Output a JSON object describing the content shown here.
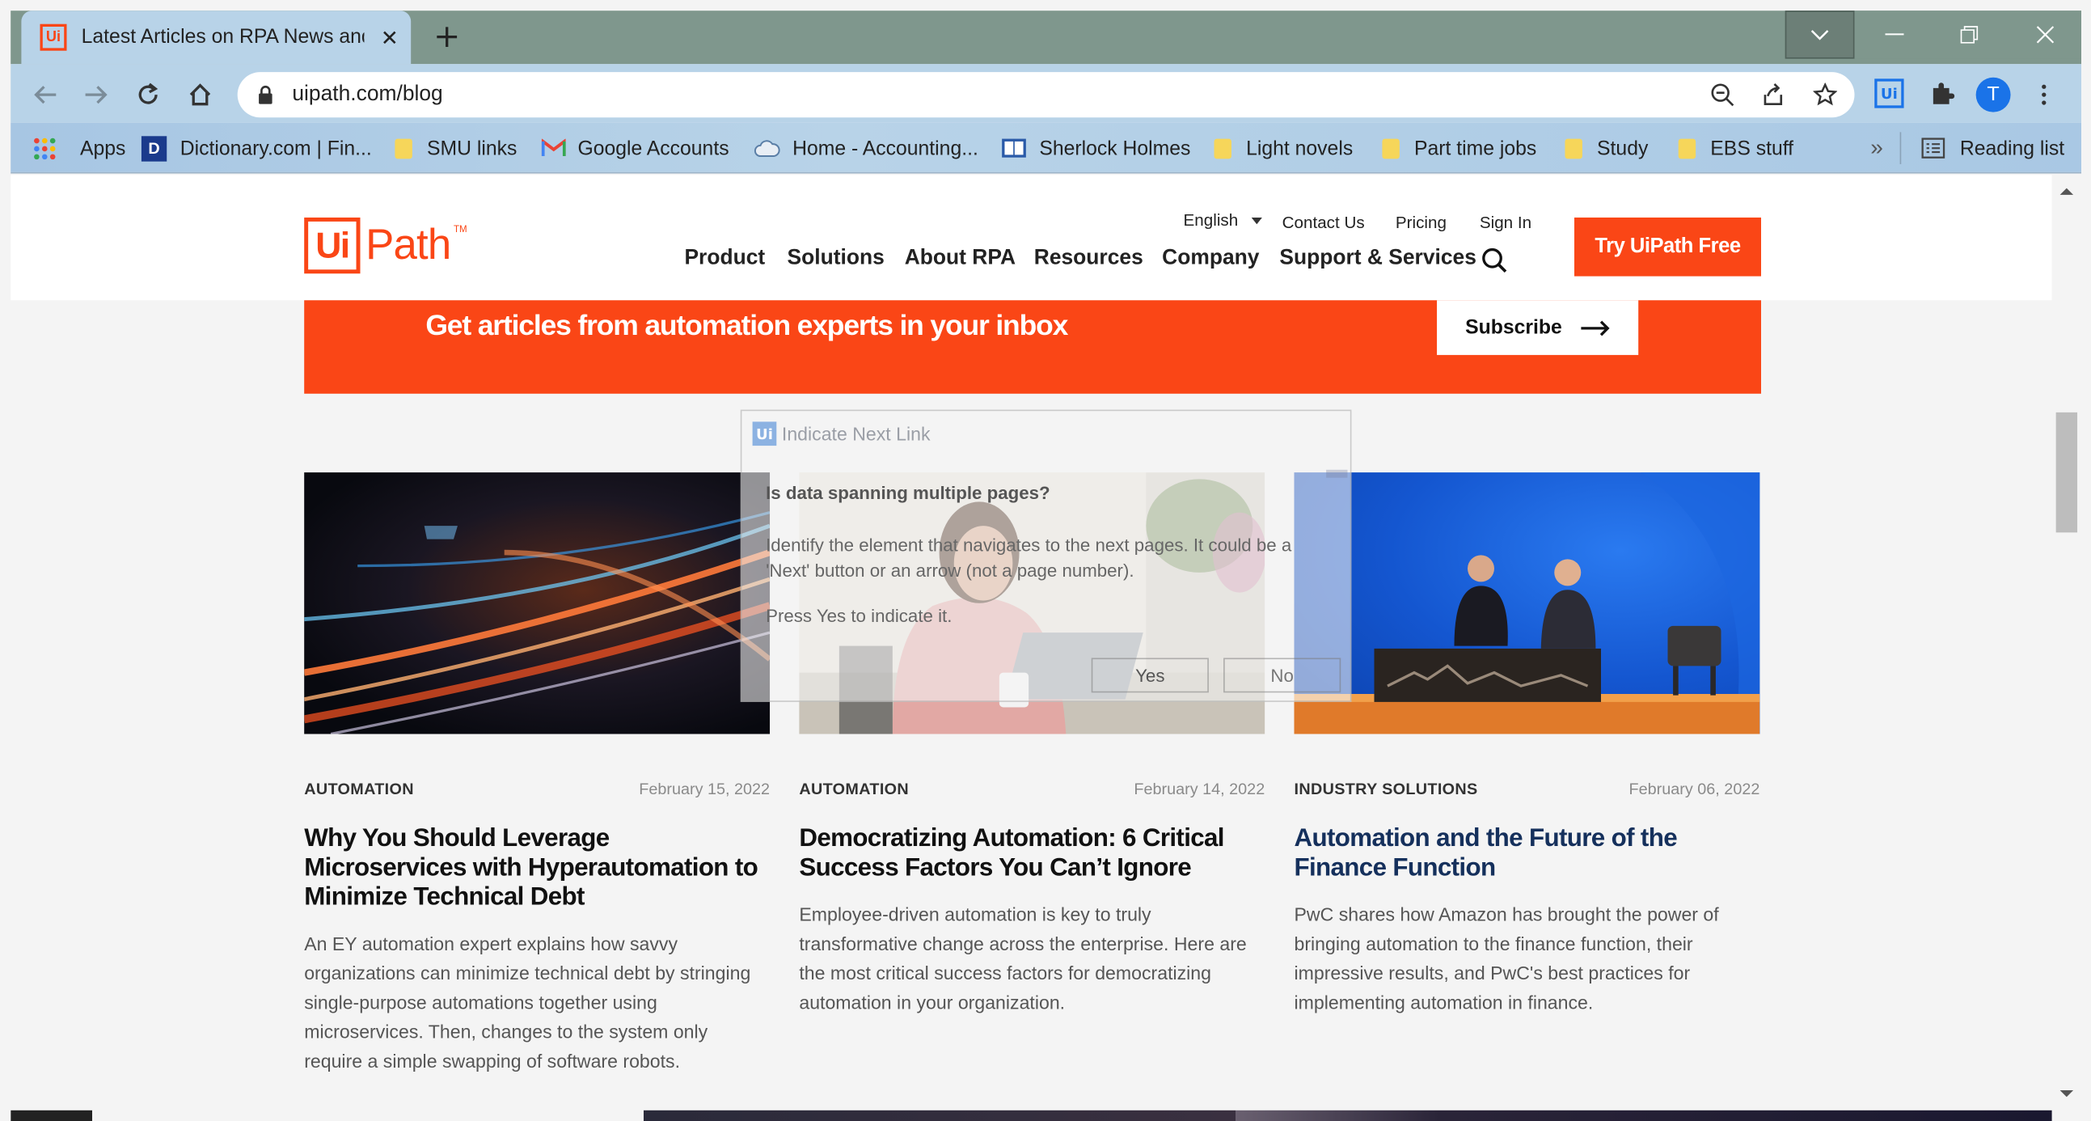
{
  "browser": {
    "tab_title": "Latest Articles on RPA News and",
    "tab_close": "✕",
    "new_tab": "+",
    "url": "uipath.com/blog",
    "profile_initial": "T",
    "extension_label": "Ui",
    "bookmarks": [
      {
        "label": "Apps",
        "icon": "apps-grid-icon"
      },
      {
        "label": "Dictionary.com | Fin...",
        "icon": "dictionary-icon"
      },
      {
        "label": "SMU links",
        "icon": "folder-icon"
      },
      {
        "label": "Google Accounts",
        "icon": "gmail-icon"
      },
      {
        "label": "Home - Accounting...",
        "icon": "cloud-icon"
      },
      {
        "label": "Sherlock Holmes",
        "icon": "book-icon"
      },
      {
        "label": "Light novels",
        "icon": "folder-icon"
      },
      {
        "label": "Part time jobs",
        "icon": "folder-icon"
      },
      {
        "label": "Study",
        "icon": "folder-icon"
      },
      {
        "label": "EBS stuff",
        "icon": "folder-icon"
      }
    ],
    "bookmarks_overflow": "»",
    "reading_list": "Reading list"
  },
  "site": {
    "logo_ui": "Ui",
    "logo_path": "Path",
    "logo_tm": "TM",
    "language": "English",
    "utility_links": [
      "Contact Us",
      "Pricing",
      "Sign In"
    ],
    "nav": [
      "Product",
      "Solutions",
      "About RPA",
      "Resources",
      "Company",
      "Support & Services"
    ],
    "cta": "Try UiPath Free",
    "brand_color": "#fa4616"
  },
  "banner": {
    "headline": "Get articles from automation experts in your inbox",
    "subscribe": "Subscribe",
    "arrow": "⟶"
  },
  "articles": [
    {
      "category": "AUTOMATION",
      "date": "February 15, 2022",
      "title": "Why You Should Leverage Microservices with Hyperautomation to Minimize Technical Debt",
      "description": "An EY automation expert explains how savvy organizations can minimize technical debt by stringing single-purpose automations together using microservices. Then, changes to the system only require a simple swapping of software robots."
    },
    {
      "category": "AUTOMATION",
      "date": "February 14, 2022",
      "title": "Democratizing Automation: 6 Critical Success Factors You Can’t Ignore",
      "description": "Employee-driven automation is key to truly transformative change across the enterprise. Here are the most critical success factors for democratizing automation in your organization."
    },
    {
      "category": "INDUSTRY SOLUTIONS",
      "date": "February 06, 2022",
      "title": "Automation and the Future of the Finance Function",
      "description": "PwC shares how Amazon has brought the power of bringing automation to the finance function, their impressive results, and PwC's best practices for implementing automation in finance."
    }
  ],
  "dialog": {
    "title_icon": "Ui",
    "title": "Indicate Next Link",
    "question": "Is data spanning multiple pages?",
    "body": "Identify the element that navigates to the next pages. It could be a 'Next' button or an arrow (not a page number).",
    "instruction": "Press Yes to indicate it.",
    "yes": "Yes",
    "no": "No"
  }
}
